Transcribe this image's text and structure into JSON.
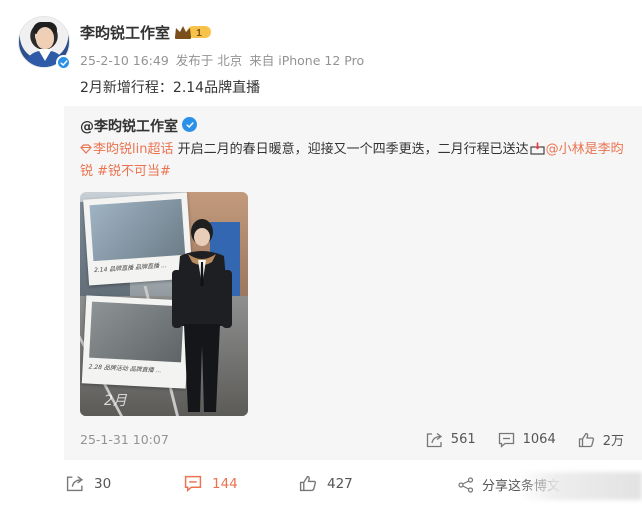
{
  "post": {
    "author": "李昀锐工作室",
    "time": "25-2-10 16:49",
    "location": "发布于 北京",
    "source": "来自 iPhone 12 Pro",
    "badge_level": "1",
    "content": "2月新增行程：2.14品牌直播"
  },
  "repost": {
    "author": "@李昀锐工作室",
    "supertopic": "李昀锐lin超话",
    "text1": " 开启二月的春日暖意，迎接又一个四季更迭，二月行程已送达",
    "mention": "@小林是李昀锐",
    "hashtag": " #锐不可当#",
    "caption1": "2.14  品牌直播  品牌直播  ...",
    "caption2": "2.28  品牌活动  品牌直播  ...",
    "photo_script": "2月",
    "time": "25-1-31 10:07",
    "actions": {
      "share_count": "561",
      "comment_count": "1064",
      "like_count": "2万"
    }
  },
  "footer": {
    "share_count": "30",
    "comment_count": "144",
    "like_count": "427",
    "share_to_label": "分享这条博文"
  },
  "colors": {
    "accent_orange": "#eb7350",
    "verified_blue": "#2b91e8",
    "repost_bg": "#f6f6f6",
    "meta_gray": "#939393"
  },
  "icons": {
    "verified": "verified-badge-icon",
    "crown": "crown-icon",
    "share": "share-icon",
    "comment": "comment-icon",
    "like": "thumbs-up-icon",
    "share_to": "share-network-icon"
  }
}
